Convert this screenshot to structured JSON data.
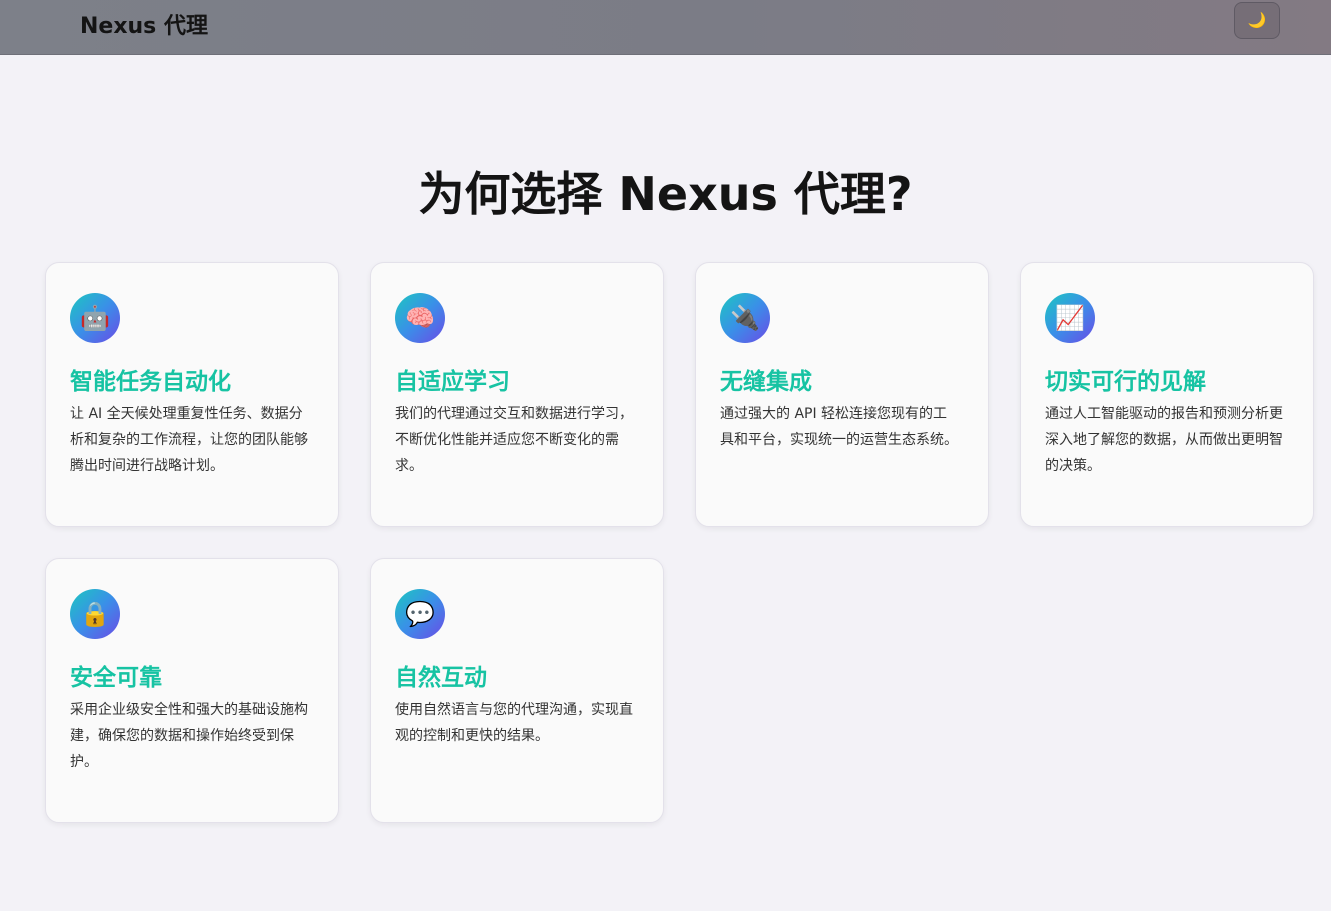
{
  "header": {
    "brand": "Nexus 代理",
    "theme_toggle_icon": "🌙"
  },
  "section": {
    "title": "为何选择 Nexus 代理?"
  },
  "features": [
    {
      "icon": "🤖",
      "icon_name": "robot-icon",
      "title": "智能任务自动化",
      "text": "让 AI 全天候处理重复性任务、数据分析和复杂的工作流程，让您的团队能够腾出时间进行战略计划。"
    },
    {
      "icon": "🧠",
      "icon_name": "brain-icon",
      "title": "自适应学习",
      "text": "我们的代理通过交互和数据进行学习，不断优化性能并适应您不断变化的需求。"
    },
    {
      "icon": "🔌",
      "icon_name": "plug-icon",
      "title": "无缝集成",
      "text": "通过强大的 API 轻松连接您现有的工具和平台，实现统一的运营生态系统。"
    },
    {
      "icon": "📈",
      "icon_name": "chart-icon",
      "title": "切实可行的见解",
      "text": "通过人工智能驱动的报告和预测分析更深入地了解您的数据，从而做出更明智的决策。"
    },
    {
      "icon": "🔒",
      "icon_name": "lock-icon",
      "title": "安全可靠",
      "text": "采用企业级安全性和强大的基础设施构建，确保您的数据和操作始终受到保护。"
    },
    {
      "icon": "💬",
      "icon_name": "speech-bubble-icon",
      "title": "自然互动",
      "text": "使用自然语言与您的代理沟通，实现直观的控制和更快的结果。"
    }
  ],
  "colors": {
    "accent": "#17c3a3",
    "background": "#f3f2f7",
    "card": "#fafafa"
  }
}
